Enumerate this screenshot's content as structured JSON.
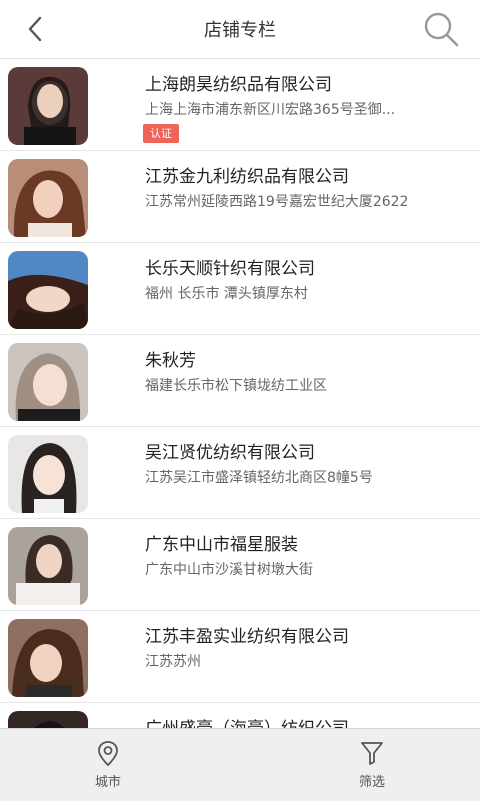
{
  "header": {
    "title": "店铺专栏",
    "back_icon": "chevron-left-icon",
    "search_icon": "search-icon"
  },
  "shops": [
    {
      "name": "上海朗昊纺织品有限公司",
      "address": "上海上海市浦东新区川宏路365号圣御...",
      "badge": "认证"
    },
    {
      "name": "江苏金九利纺织品有限公司",
      "address": "江苏常州延陵西路19号嘉宏世纪大厦2622"
    },
    {
      "name": "长乐天顺针织有限公司",
      "address": "福州 长乐市 潭头镇厚东村"
    },
    {
      "name": "朱秋芳",
      "address": "福建长乐市松下镇垅纺工业区"
    },
    {
      "name": "吴江贤优纺织有限公司",
      "address": "江苏吴江市盛泽镇轻纺北商区8幢5号"
    },
    {
      "name": "广东中山市福星服装",
      "address": "广东中山市沙溪甘树墩大街"
    },
    {
      "name": "江苏丰盈实业纺织有限公司",
      "address": "江苏苏州"
    },
    {
      "name": "广州盛豪（海豪）纺织公司",
      "address": ""
    }
  ],
  "bottom_nav": {
    "city_label": "城市",
    "city_icon": "location-pin-icon",
    "filter_label": "筛选",
    "filter_icon": "filter-funnel-icon"
  },
  "colors": {
    "badge": "#ee6457",
    "background": "#ffffff",
    "bottom_bar": "#efefef"
  }
}
